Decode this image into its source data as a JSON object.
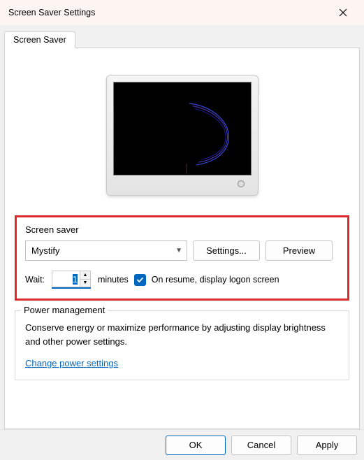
{
  "window": {
    "title": "Screen Saver Settings"
  },
  "tab": {
    "label": "Screen Saver"
  },
  "screensaver": {
    "group_title": "Screen saver",
    "selected": "Mystify",
    "settings_button": "Settings...",
    "preview_button": "Preview",
    "wait_label": "Wait:",
    "wait_value": "1",
    "wait_unit": "minutes",
    "resume_checked": true,
    "resume_label": "On resume, display logon screen"
  },
  "power": {
    "group_title": "Power management",
    "desc": "Conserve energy or maximize performance by adjusting display brightness and other power settings.",
    "link": "Change power settings"
  },
  "buttons": {
    "ok": "OK",
    "cancel": "Cancel",
    "apply": "Apply"
  }
}
